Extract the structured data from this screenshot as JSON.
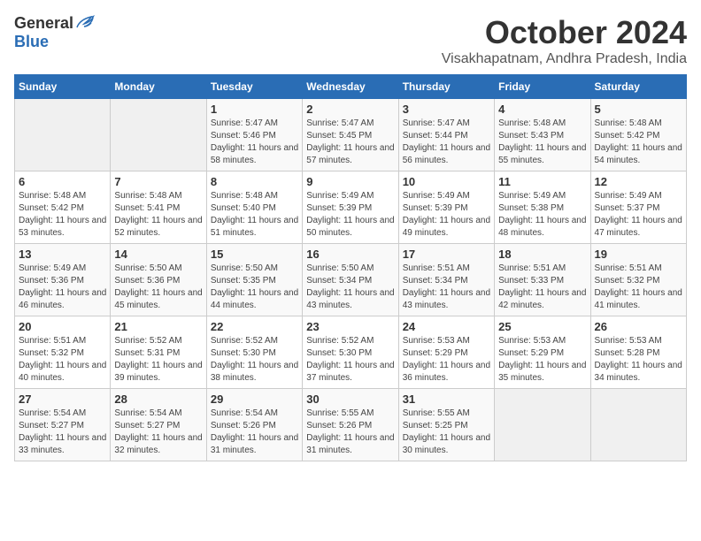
{
  "header": {
    "logo_general": "General",
    "logo_blue": "Blue",
    "month_title": "October 2024",
    "location": "Visakhapatnam, Andhra Pradesh, India"
  },
  "days_of_week": [
    "Sunday",
    "Monday",
    "Tuesday",
    "Wednesday",
    "Thursday",
    "Friday",
    "Saturday"
  ],
  "weeks": [
    [
      {
        "day": "",
        "sunrise": "",
        "sunset": "",
        "daylight": "",
        "empty": true
      },
      {
        "day": "",
        "sunrise": "",
        "sunset": "",
        "daylight": "",
        "empty": true
      },
      {
        "day": "1",
        "sunrise": "Sunrise: 5:47 AM",
        "sunset": "Sunset: 5:46 PM",
        "daylight": "Daylight: 11 hours and 58 minutes.",
        "empty": false
      },
      {
        "day": "2",
        "sunrise": "Sunrise: 5:47 AM",
        "sunset": "Sunset: 5:45 PM",
        "daylight": "Daylight: 11 hours and 57 minutes.",
        "empty": false
      },
      {
        "day": "3",
        "sunrise": "Sunrise: 5:47 AM",
        "sunset": "Sunset: 5:44 PM",
        "daylight": "Daylight: 11 hours and 56 minutes.",
        "empty": false
      },
      {
        "day": "4",
        "sunrise": "Sunrise: 5:48 AM",
        "sunset": "Sunset: 5:43 PM",
        "daylight": "Daylight: 11 hours and 55 minutes.",
        "empty": false
      },
      {
        "day": "5",
        "sunrise": "Sunrise: 5:48 AM",
        "sunset": "Sunset: 5:42 PM",
        "daylight": "Daylight: 11 hours and 54 minutes.",
        "empty": false
      }
    ],
    [
      {
        "day": "6",
        "sunrise": "Sunrise: 5:48 AM",
        "sunset": "Sunset: 5:42 PM",
        "daylight": "Daylight: 11 hours and 53 minutes.",
        "empty": false
      },
      {
        "day": "7",
        "sunrise": "Sunrise: 5:48 AM",
        "sunset": "Sunset: 5:41 PM",
        "daylight": "Daylight: 11 hours and 52 minutes.",
        "empty": false
      },
      {
        "day": "8",
        "sunrise": "Sunrise: 5:48 AM",
        "sunset": "Sunset: 5:40 PM",
        "daylight": "Daylight: 11 hours and 51 minutes.",
        "empty": false
      },
      {
        "day": "9",
        "sunrise": "Sunrise: 5:49 AM",
        "sunset": "Sunset: 5:39 PM",
        "daylight": "Daylight: 11 hours and 50 minutes.",
        "empty": false
      },
      {
        "day": "10",
        "sunrise": "Sunrise: 5:49 AM",
        "sunset": "Sunset: 5:39 PM",
        "daylight": "Daylight: 11 hours and 49 minutes.",
        "empty": false
      },
      {
        "day": "11",
        "sunrise": "Sunrise: 5:49 AM",
        "sunset": "Sunset: 5:38 PM",
        "daylight": "Daylight: 11 hours and 48 minutes.",
        "empty": false
      },
      {
        "day": "12",
        "sunrise": "Sunrise: 5:49 AM",
        "sunset": "Sunset: 5:37 PM",
        "daylight": "Daylight: 11 hours and 47 minutes.",
        "empty": false
      }
    ],
    [
      {
        "day": "13",
        "sunrise": "Sunrise: 5:49 AM",
        "sunset": "Sunset: 5:36 PM",
        "daylight": "Daylight: 11 hours and 46 minutes.",
        "empty": false
      },
      {
        "day": "14",
        "sunrise": "Sunrise: 5:50 AM",
        "sunset": "Sunset: 5:36 PM",
        "daylight": "Daylight: 11 hours and 45 minutes.",
        "empty": false
      },
      {
        "day": "15",
        "sunrise": "Sunrise: 5:50 AM",
        "sunset": "Sunset: 5:35 PM",
        "daylight": "Daylight: 11 hours and 44 minutes.",
        "empty": false
      },
      {
        "day": "16",
        "sunrise": "Sunrise: 5:50 AM",
        "sunset": "Sunset: 5:34 PM",
        "daylight": "Daylight: 11 hours and 43 minutes.",
        "empty": false
      },
      {
        "day": "17",
        "sunrise": "Sunrise: 5:51 AM",
        "sunset": "Sunset: 5:34 PM",
        "daylight": "Daylight: 11 hours and 43 minutes.",
        "empty": false
      },
      {
        "day": "18",
        "sunrise": "Sunrise: 5:51 AM",
        "sunset": "Sunset: 5:33 PM",
        "daylight": "Daylight: 11 hours and 42 minutes.",
        "empty": false
      },
      {
        "day": "19",
        "sunrise": "Sunrise: 5:51 AM",
        "sunset": "Sunset: 5:32 PM",
        "daylight": "Daylight: 11 hours and 41 minutes.",
        "empty": false
      }
    ],
    [
      {
        "day": "20",
        "sunrise": "Sunrise: 5:51 AM",
        "sunset": "Sunset: 5:32 PM",
        "daylight": "Daylight: 11 hours and 40 minutes.",
        "empty": false
      },
      {
        "day": "21",
        "sunrise": "Sunrise: 5:52 AM",
        "sunset": "Sunset: 5:31 PM",
        "daylight": "Daylight: 11 hours and 39 minutes.",
        "empty": false
      },
      {
        "day": "22",
        "sunrise": "Sunrise: 5:52 AM",
        "sunset": "Sunset: 5:30 PM",
        "daylight": "Daylight: 11 hours and 38 minutes.",
        "empty": false
      },
      {
        "day": "23",
        "sunrise": "Sunrise: 5:52 AM",
        "sunset": "Sunset: 5:30 PM",
        "daylight": "Daylight: 11 hours and 37 minutes.",
        "empty": false
      },
      {
        "day": "24",
        "sunrise": "Sunrise: 5:53 AM",
        "sunset": "Sunset: 5:29 PM",
        "daylight": "Daylight: 11 hours and 36 minutes.",
        "empty": false
      },
      {
        "day": "25",
        "sunrise": "Sunrise: 5:53 AM",
        "sunset": "Sunset: 5:29 PM",
        "daylight": "Daylight: 11 hours and 35 minutes.",
        "empty": false
      },
      {
        "day": "26",
        "sunrise": "Sunrise: 5:53 AM",
        "sunset": "Sunset: 5:28 PM",
        "daylight": "Daylight: 11 hours and 34 minutes.",
        "empty": false
      }
    ],
    [
      {
        "day": "27",
        "sunrise": "Sunrise: 5:54 AM",
        "sunset": "Sunset: 5:27 PM",
        "daylight": "Daylight: 11 hours and 33 minutes.",
        "empty": false
      },
      {
        "day": "28",
        "sunrise": "Sunrise: 5:54 AM",
        "sunset": "Sunset: 5:27 PM",
        "daylight": "Daylight: 11 hours and 32 minutes.",
        "empty": false
      },
      {
        "day": "29",
        "sunrise": "Sunrise: 5:54 AM",
        "sunset": "Sunset: 5:26 PM",
        "daylight": "Daylight: 11 hours and 31 minutes.",
        "empty": false
      },
      {
        "day": "30",
        "sunrise": "Sunrise: 5:55 AM",
        "sunset": "Sunset: 5:26 PM",
        "daylight": "Daylight: 11 hours and 31 minutes.",
        "empty": false
      },
      {
        "day": "31",
        "sunrise": "Sunrise: 5:55 AM",
        "sunset": "Sunset: 5:25 PM",
        "daylight": "Daylight: 11 hours and 30 minutes.",
        "empty": false
      },
      {
        "day": "",
        "sunrise": "",
        "sunset": "",
        "daylight": "",
        "empty": true
      },
      {
        "day": "",
        "sunrise": "",
        "sunset": "",
        "daylight": "",
        "empty": true
      }
    ]
  ]
}
